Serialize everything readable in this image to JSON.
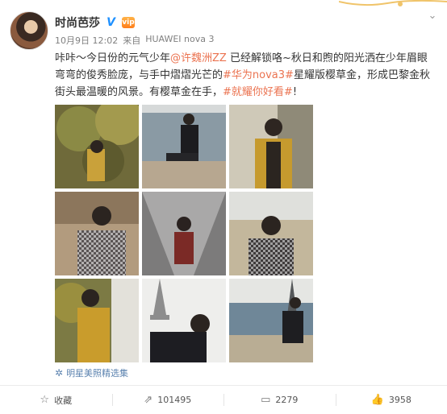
{
  "post": {
    "author": "时尚芭莎",
    "verified_icon": "V",
    "vip_icon": "vip",
    "meta": {
      "date": "10月9日 12:02",
      "source_prefix": "来自",
      "device": "HUAWEI nova 3"
    },
    "text": {
      "part1": "咔咔～今日份的元气少年",
      "mention": "@许魏洲ZZ",
      "part2": " 已经解锁咯~秋日和煦的阳光洒在少年眉眼弯弯的俊秀脸庞，与手中熠熠光芒的",
      "tag1": "#华为nova3#",
      "part3": "星耀版樱草金，形成巴黎金秋街头最温暖的风景。有樱草金在手，",
      "tag2": "#就耀你好看#",
      "part4": "!"
    },
    "photos": [
      "photo-1",
      "photo-2",
      "photo-3",
      "photo-4",
      "photo-5",
      "photo-6",
      "photo-7",
      "photo-8",
      "photo-9"
    ],
    "source_label": "明星美照精选集"
  },
  "actions": {
    "favorite": "收藏",
    "repost": "101495",
    "comment": "2279",
    "like": "3958"
  },
  "colors": {
    "link": "#eb7350",
    "source": "#5d84b0",
    "verified": "#1e90ff"
  }
}
